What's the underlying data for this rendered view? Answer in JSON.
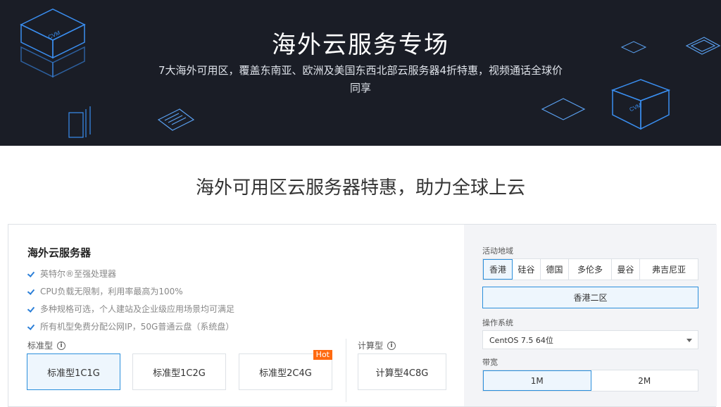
{
  "banner": {
    "title": "海外云服务专场",
    "subtitle_line1": "7大海外可用区，覆盖东南亚、欧洲及美国东西北部云服务器4折特惠，视频通话全球价",
    "subtitle_line2": "同享",
    "deco_label": "CVM"
  },
  "section": {
    "title": "海外可用区云服务器特惠，助力全球上云"
  },
  "product": {
    "title": "海外云服务器",
    "features": [
      "英特尔®至强处理器",
      "CPU负载无限制，利用率最高为100%",
      "多种规格可选，个人建站及企业级应用场景均可满足",
      "所有机型免费分配公网IP，50G普通云盘（系统盘）"
    ],
    "standard_label": "标准型",
    "compute_label": "计算型",
    "standard_specs": [
      "标准型1C1G",
      "标准型1C2G",
      "标准型2C4G"
    ],
    "compute_specs": [
      "计算型4C8G"
    ],
    "hot_badge": "Hot",
    "info_glyph": "i"
  },
  "config": {
    "region_label": "活动地域",
    "regions": [
      "香港",
      "硅谷",
      "德国",
      "多伦多",
      "曼谷",
      "弗吉尼亚"
    ],
    "zone": "香港二区",
    "os_label": "操作系统",
    "os_value": "CentOS 7.5 64位",
    "bandwidth_label": "带宽",
    "bandwidth_options": [
      "1M",
      "2M"
    ]
  },
  "colors": {
    "accent": "#2b8fdc",
    "hot": "#ff6a10",
    "banner_bg": "#1a1d26"
  }
}
